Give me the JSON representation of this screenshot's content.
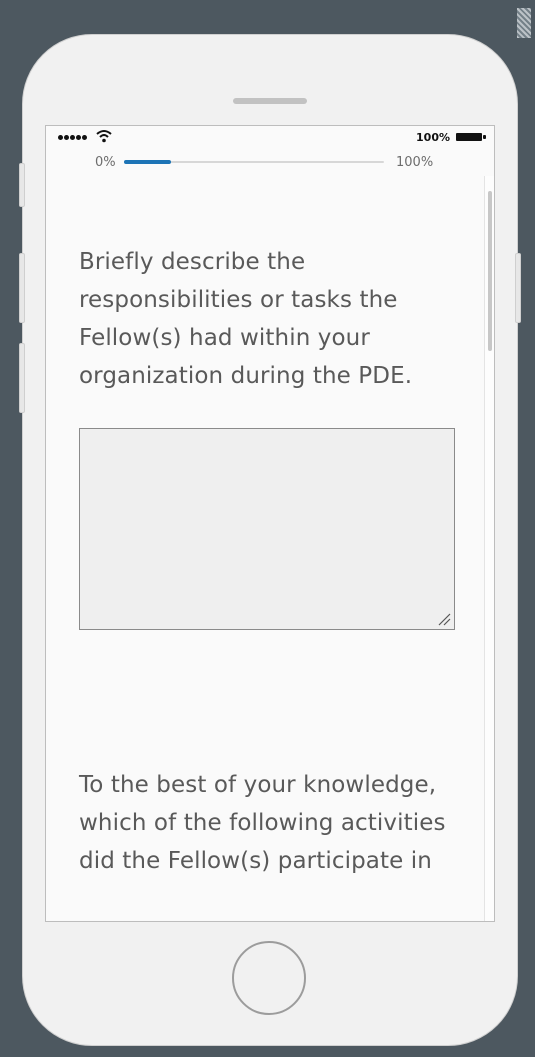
{
  "status_bar": {
    "battery_percent": "100%"
  },
  "progress": {
    "start_label": "0%",
    "end_label": "100%",
    "value_fraction": 0.18
  },
  "questions": [
    {
      "text": "Briefly describe the responsibilities or tasks the Fellow(s) had within your organization during the PDE."
    },
    {
      "text": "To the best of your knowledge, which of the following activities did the Fellow(s) participate in"
    }
  ],
  "response_field": {
    "value": "",
    "placeholder": ""
  },
  "icons": {
    "signal": "signal-dots-icon",
    "wifi": "wifi-icon",
    "battery": "battery-icon",
    "resize": "resize-grip-icon",
    "home": "home-button-icon"
  },
  "colors": {
    "background": "#4d5860",
    "phone_body": "#f1f1f1",
    "progress_fill": "#1d74b6",
    "question_text": "#595959"
  }
}
